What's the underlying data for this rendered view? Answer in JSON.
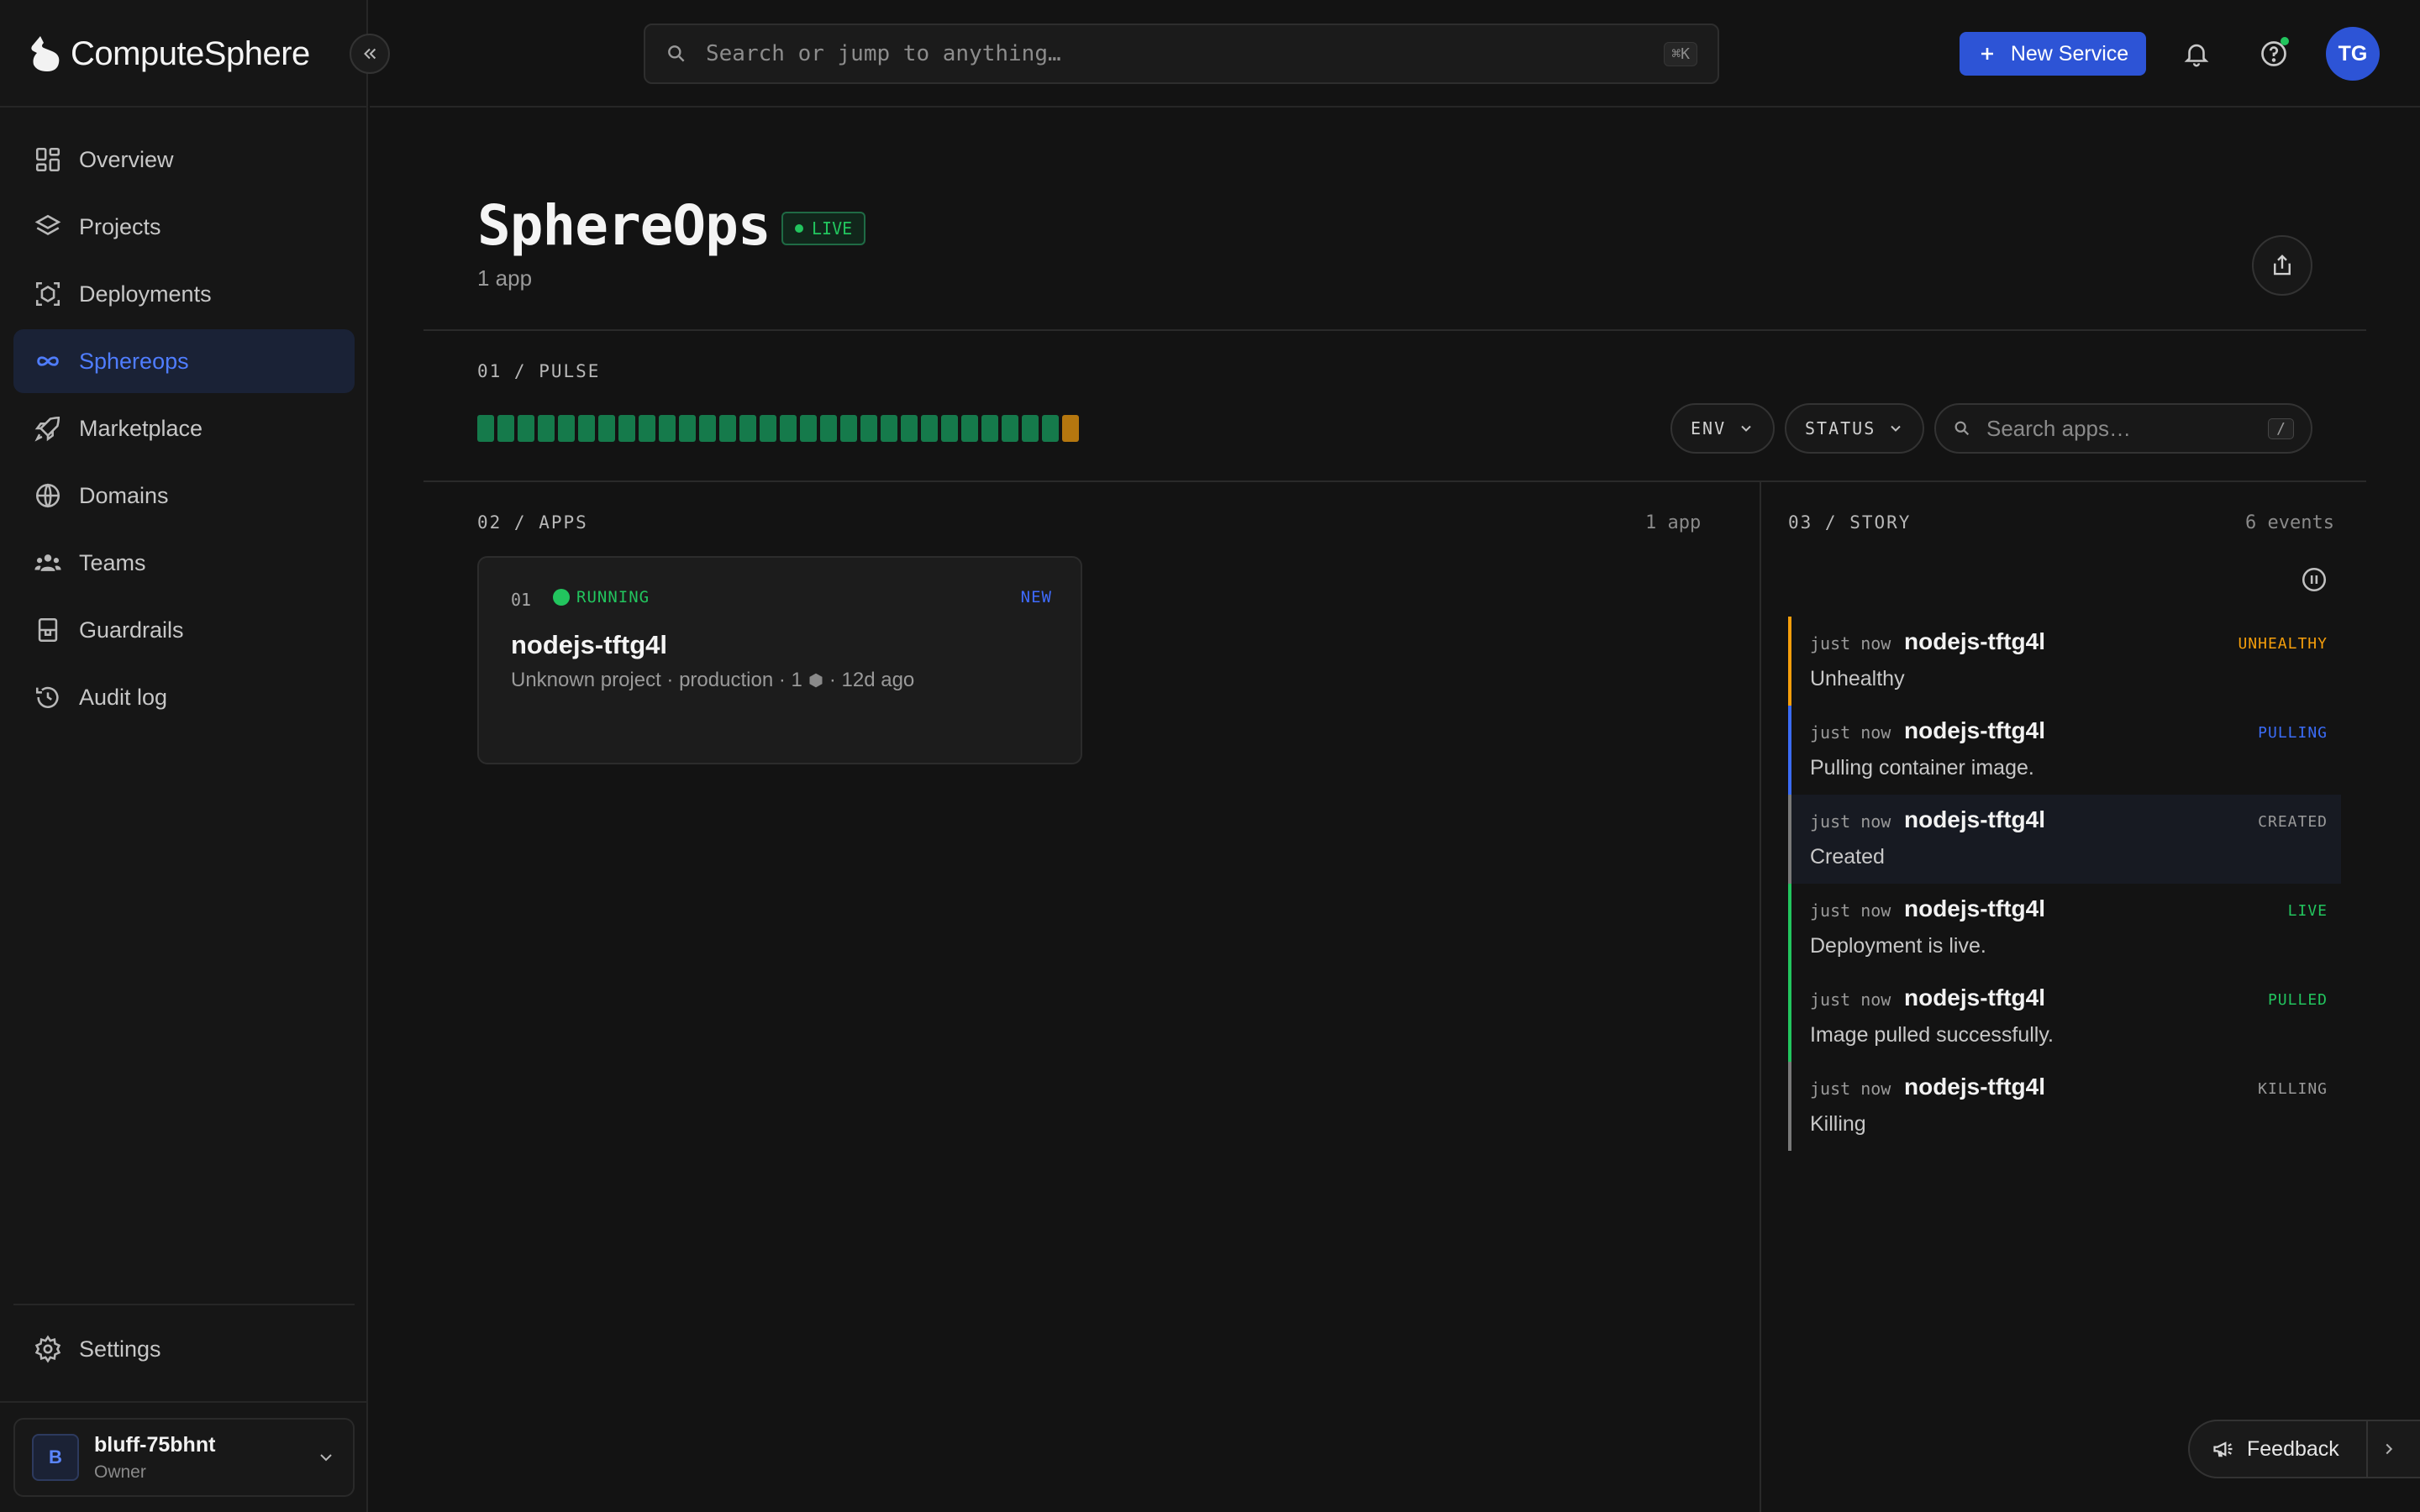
{
  "brand": {
    "name": "ComputeSphere"
  },
  "sidebar": {
    "items": [
      {
        "label": "Overview",
        "icon": "dashboard-icon"
      },
      {
        "label": "Projects",
        "icon": "layers-icon"
      },
      {
        "label": "Deployments",
        "icon": "cube-icon"
      },
      {
        "label": "Sphereops",
        "icon": "infinity-icon",
        "active": true
      },
      {
        "label": "Marketplace",
        "icon": "rocket-icon"
      },
      {
        "label": "Domains",
        "icon": "globe-icon"
      },
      {
        "label": "Teams",
        "icon": "users-icon"
      },
      {
        "label": "Guardrails",
        "icon": "guardrail-icon"
      },
      {
        "label": "Audit log",
        "icon": "history-icon"
      }
    ],
    "settings_label": "Settings",
    "workspace": {
      "initial": "B",
      "name": "bluff-75bhnt",
      "role": "Owner"
    }
  },
  "topbar": {
    "search_placeholder": "Search or jump to anything…",
    "search_shortcut": "⌘K",
    "new_service_label": "New Service",
    "user_initials": "TG"
  },
  "page": {
    "title": "SphereOps",
    "badge": "LIVE",
    "subtitle": "1 app"
  },
  "pulse": {
    "label": "01 / PULSE",
    "bars": [
      "ok",
      "ok",
      "ok",
      "ok",
      "ok",
      "ok",
      "ok",
      "ok",
      "ok",
      "ok",
      "ok",
      "ok",
      "ok",
      "ok",
      "ok",
      "ok",
      "ok",
      "ok",
      "ok",
      "ok",
      "ok",
      "ok",
      "ok",
      "ok",
      "ok",
      "ok",
      "ok",
      "ok",
      "ok",
      "warn"
    ]
  },
  "filters": {
    "env_label": "ENV",
    "status_label": "STATUS",
    "search_placeholder": "Search apps…",
    "search_shortcut": "/"
  },
  "apps": {
    "label": "02 / APPS",
    "count": "1 app",
    "items": [
      {
        "index": "01",
        "status": "RUNNING",
        "tag": "NEW",
        "name": "nodejs-tftg4l",
        "meta_prefix": "Unknown project · production · 1",
        "meta_suffix": "· 12d ago"
      }
    ]
  },
  "story": {
    "label": "03 / STORY",
    "count": "6 events",
    "events": [
      {
        "time": "just now",
        "app": "nodejs-tftg4l",
        "status": "UNHEALTHY",
        "message": "Unhealthy",
        "color": "#f59e0b"
      },
      {
        "time": "just now",
        "app": "nodejs-tftg4l",
        "status": "PULLING",
        "message": "Pulling container image.",
        "color": "#3b6cf6"
      },
      {
        "time": "just now",
        "app": "nodejs-tftg4l",
        "status": "CREATED",
        "message": "Created",
        "color": "#7a7a7a"
      },
      {
        "time": "just now",
        "app": "nodejs-tftg4l",
        "status": "LIVE",
        "message": "Deployment is live.",
        "color": "#22c55e"
      },
      {
        "time": "just now",
        "app": "nodejs-tftg4l",
        "status": "PULLED",
        "message": "Image pulled successfully.",
        "color": "#22c55e"
      },
      {
        "time": "just now",
        "app": "nodejs-tftg4l",
        "status": "KILLING",
        "message": "Killing",
        "color": "#7a7a7a"
      }
    ]
  },
  "feedback": {
    "label": "Feedback"
  },
  "colors": {
    "accent": "#2d54d6",
    "success": "#22c55e",
    "warning": "#f59e0b",
    "background": "#131313"
  }
}
